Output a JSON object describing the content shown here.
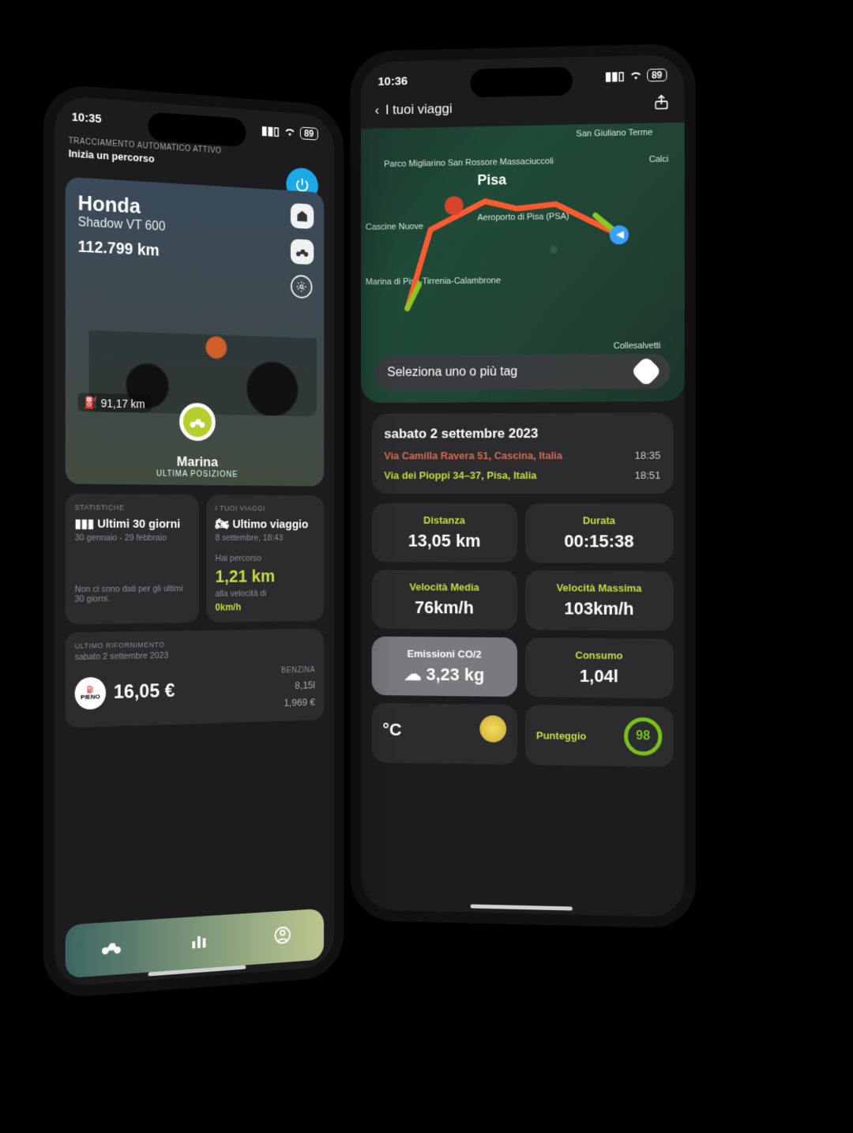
{
  "left": {
    "status": {
      "time": "10:35",
      "battery": "89"
    },
    "header": {
      "tracking_label": "TRACCIAMENTO AUTOMATICO ATTIVO",
      "start_route": "Inizia un percorso"
    },
    "vehicle": {
      "brand": "Honda",
      "model": "Shadow VT 600",
      "odometer": "112.799 km",
      "fuel_range": "91,17 km",
      "last_position_name": "Marina",
      "last_position_label": "ULTIMA POSIZIONE"
    },
    "stats": {
      "section": "STATISTICHE",
      "title": "Ultimi 30 giorni",
      "range": "30 gennaio - 29 febbraio",
      "empty": "Non ci sono dati per gli ultimi 30 giorni."
    },
    "trips": {
      "section": "I TUOI VIAGGI",
      "title": "Ultimo viaggio",
      "when": "8 settembre, 18:43",
      "covered_label": "Hai percorso",
      "distance": "1,21 km",
      "speed_label": "alla velocità di",
      "speed": "0km/h"
    },
    "refuel": {
      "section": "ULTIMO RIFORNIMENTO",
      "date": "sabato 2 settembre 2023",
      "badge": "PIENO",
      "amount": "16,05 €",
      "fuel_type": "BENZINA",
      "liters": "8,15l",
      "price_per": "1,969 €"
    }
  },
  "right": {
    "status": {
      "time": "10:36",
      "battery": "89"
    },
    "nav": {
      "back": "I tuoi viaggi"
    },
    "map": {
      "city": "Pisa",
      "labels": {
        "l1": "San Giuliano Terme",
        "l2": "Parco Migliarino San Rossore Massaciuccoli",
        "l3": "Cascine Nuove",
        "l4": "Aeroporto di Pisa (PSA)",
        "l5": "Marina di Pisa-Tirrenia-Calambrone",
        "l6": "Calci",
        "l7": "Collesalvetti"
      },
      "tag_prompt": "Seleziona uno o più tag"
    },
    "trip": {
      "date": "sabato 2 settembre 2023",
      "start_addr": "Via Camilla Ravera 51, Cascina, Italia",
      "start_time": "18:35",
      "end_addr": "Via dei Pioppi 34–37, Pisa, Italia",
      "end_time": "18:51"
    },
    "metrics": {
      "distance_label": "Distanza",
      "distance": "13,05 km",
      "duration_label": "Durata",
      "duration": "00:15:38",
      "avg_speed_label": "Velocità Media",
      "avg_speed": "76km/h",
      "max_speed_label": "Velocità Massima",
      "max_speed": "103km/h",
      "co2_label": "Emissioni CO/2",
      "co2": "3,23 kg",
      "consumption_label": "Consumo",
      "consumption": "1,04l",
      "weather_temp": "°C",
      "score_label": "Punteggio",
      "score": "98"
    }
  }
}
